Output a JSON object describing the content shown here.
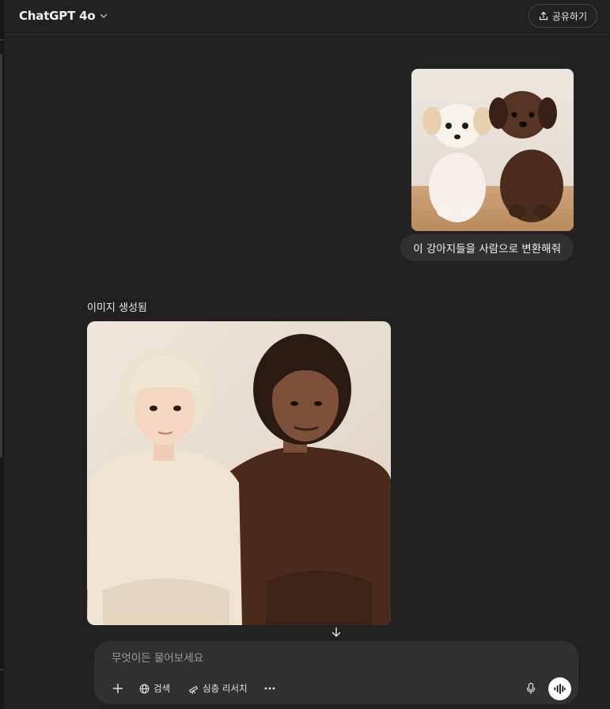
{
  "header": {
    "model_name": "ChatGPT 4o",
    "share_label": "공유하기"
  },
  "conversation": {
    "user_message": {
      "image_alt": "흰색 강아지와 갈색 강아지",
      "text": "이 강아지들을 사람으로 변환해줘"
    },
    "assistant_message": {
      "status_label": "이미지 생성됨",
      "image_alt": "밝은 색 머리의 사람과 갈색 머리의 사람"
    }
  },
  "composer": {
    "placeholder": "무엇이든 물어보세요",
    "search_label": "검색",
    "deep_research_label": "심층 리서치"
  },
  "colors": {
    "background": "#212121",
    "composer": "#303030",
    "bubble": "#303030",
    "text": "#ececec"
  }
}
